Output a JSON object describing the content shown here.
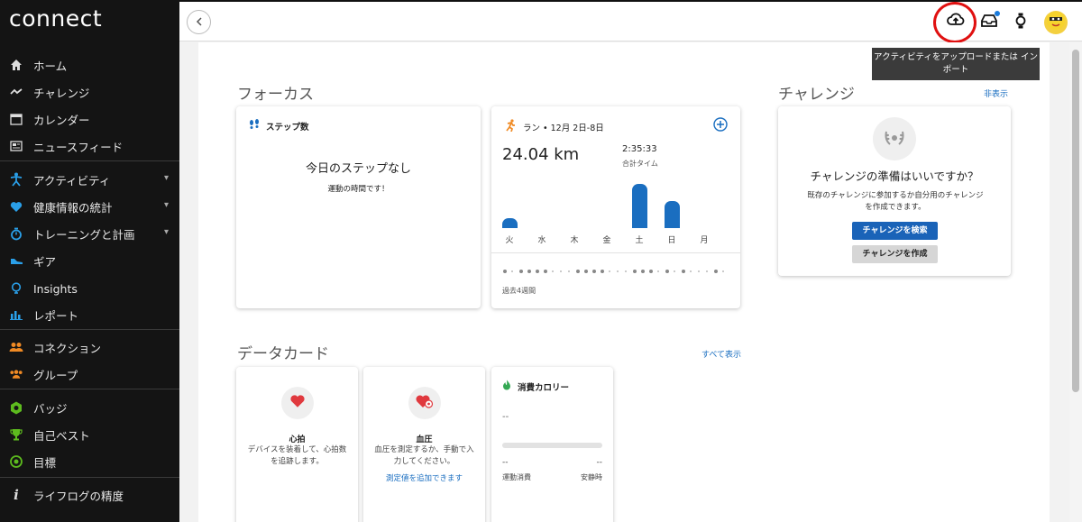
{
  "app": {
    "logo": "connect"
  },
  "sidebar": {
    "items": [
      {
        "label": "ホーム",
        "icon": "home-icon"
      },
      {
        "label": "チャレンジ",
        "icon": "challenge-icon"
      },
      {
        "label": "カレンダー",
        "icon": "calendar-icon"
      },
      {
        "label": "ニュースフィード",
        "icon": "newsfeed-icon"
      },
      {
        "label": "アクティビティ",
        "icon": "activity-icon"
      },
      {
        "label": "健康情報の統計",
        "icon": "heart-icon"
      },
      {
        "label": "トレーニングと計画",
        "icon": "stopwatch-icon"
      },
      {
        "label": "ギア",
        "icon": "shoe-icon"
      },
      {
        "label": "Insights",
        "icon": "lightbulb-icon"
      },
      {
        "label": "レポート",
        "icon": "bar-chart-icon"
      },
      {
        "label": "コネクション",
        "icon": "connections-icon"
      },
      {
        "label": "グループ",
        "icon": "groups-icon"
      },
      {
        "label": "バッジ",
        "icon": "badge-icon"
      },
      {
        "label": "自己ベスト",
        "icon": "trophy-icon"
      },
      {
        "label": "目標",
        "icon": "target-icon"
      },
      {
        "label": "ライフログの精度",
        "icon": "info-icon"
      }
    ]
  },
  "topbar": {
    "tooltip": "アクティビティをアップロードまたは インポート"
  },
  "focus": {
    "title": "フォーカス",
    "steps": {
      "head": "ステップ数",
      "empty_title": "今日のステップなし",
      "empty_sub": "運動の時間です！"
    },
    "run": {
      "head": "ラン • 12月 2日-8日",
      "distance": "24.04 km",
      "time": "2:35:33",
      "time_label": "合計タイム",
      "days": [
        "火",
        "水",
        "木",
        "金",
        "土",
        "日",
        "月"
      ],
      "day_values": [
        0.22,
        0,
        0,
        0,
        1.0,
        0.62,
        0
      ],
      "past_label": "過去4週間"
    }
  },
  "challenge": {
    "title": "チャレンジ",
    "hide": "非表示",
    "question": "チャレンジの準備はいいですか？",
    "desc": "既存のチャレンジに参加するか自分用のチャレンジを作成できます。",
    "search_btn": "チャレンジを検索",
    "create_btn": "チャレンジを作成"
  },
  "datacards": {
    "title": "データカード",
    "show_all": "すべて表示",
    "heart": {
      "title": "心拍",
      "desc": "デバイスを装着して、心拍数を追跡します。"
    },
    "bp": {
      "title": "血圧",
      "desc": "血圧を測定するか、手動で入力してください。",
      "link": "測定値を追加できます"
    },
    "calories": {
      "head": "消費カロリー",
      "value": "--",
      "active_val": "--",
      "rest_val": "--",
      "active_label": "運動消費",
      "rest_label": "安静時"
    }
  }
}
